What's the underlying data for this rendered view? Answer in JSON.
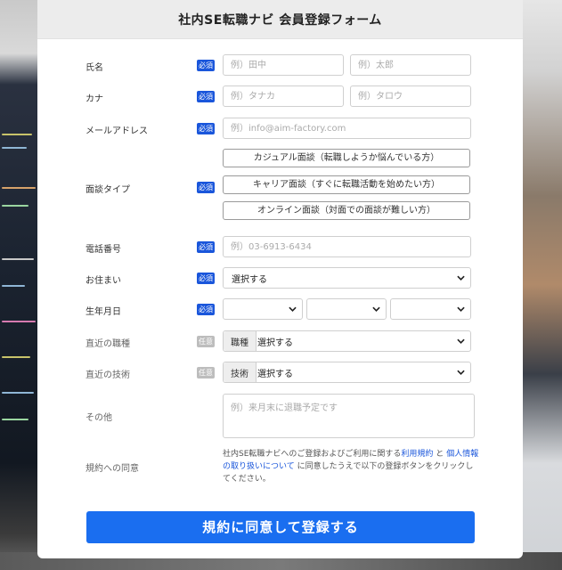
{
  "form": {
    "title": "社内SE転職ナビ 会員登録フォーム",
    "badges": {
      "required": "必須",
      "optional": "任意"
    },
    "name": {
      "label": "氏名",
      "last_placeholder": "例）田中",
      "first_placeholder": "例）太郎"
    },
    "kana": {
      "label": "カナ",
      "last_placeholder": "例）タナカ",
      "first_placeholder": "例）タロウ"
    },
    "email": {
      "label": "メールアドレス",
      "placeholder": "例）info@aim-factory.com"
    },
    "interview_type": {
      "label": "面談タイプ",
      "options": [
        "カジュアル面談（転職しようか悩んでいる方）",
        "キャリア面談（すぐに転職活動を始めたい方）",
        "オンライン面談（対面での面談が難しい方）"
      ]
    },
    "phone": {
      "label": "電話番号",
      "placeholder": "例）03-6913-6434"
    },
    "residence": {
      "label": "お住まい",
      "value": "選択する"
    },
    "birthdate": {
      "label": "生年月日",
      "year": "",
      "month": "",
      "day": ""
    },
    "recent_job": {
      "label": "直近の職種",
      "prefix": "職種",
      "value": "選択する"
    },
    "recent_skill": {
      "label": "直近の技術",
      "prefix": "技術",
      "value": "選択する"
    },
    "other": {
      "label": "その他",
      "placeholder": "例）来月末に退職予定です"
    },
    "agreement": {
      "label": "規約への同意",
      "text_before": "社内SE転職ナビへのご登録およびご利用に関する",
      "link_terms": "利用規約",
      "text_and": "と",
      "link_privacy": "個人情報の取り扱いについて",
      "text_after": "に同意したうえで以下の登録ボタンをクリックしてください。"
    },
    "submit_label": "規約に同意して登録する"
  },
  "colors": {
    "accent": "#1a56db",
    "submit": "#1a6ef0"
  }
}
